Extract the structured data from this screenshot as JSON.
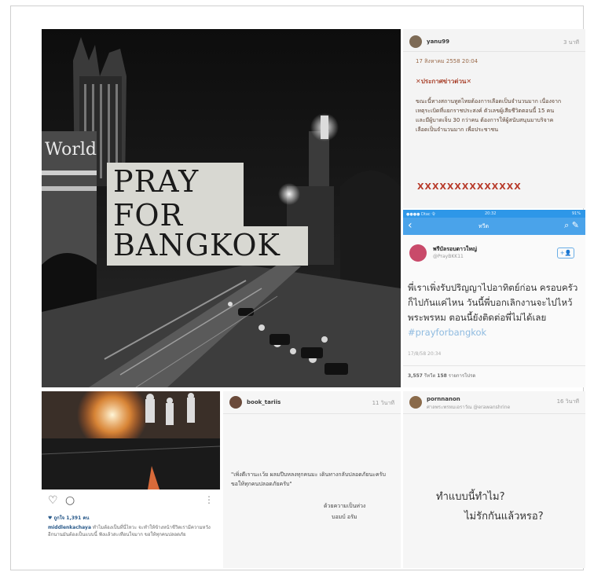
{
  "hero": {
    "line1": "PRAY",
    "line2": "FOR",
    "line3": "BANGKOK",
    "sign_text": "World"
  },
  "note_card": {
    "username": "yanu99",
    "ago": "3 นาที",
    "date": "17 สิงหาคม 2558 20:04",
    "heading": "ประกาศข่าวด่วน",
    "body": "ขณะนี้ทางสถานทูตไทยต้องการเลือดเป็นจำนวนมาก เนื่องจาก เหตุระเบิดที่แยกราชประสงค์ ตัวเลขผู้เสียชีวิตตอนนี้ 15 คน และมีผู้บาดเจ็บ 30 กว่าคน ต้องการให้ผู้สนับสนุนมาบริจาคเลือดเป็นจำนวนมาก เพื่อประชาชน",
    "x_mark": "✕",
    "x_row": "XXXXXXXXXXXXXX"
  },
  "tweet": {
    "status_left": "●●●● Dtac 令",
    "status_time": "20:32",
    "status_right": "91%",
    "title": "ทวีต",
    "back": "‹",
    "icons": "⌕  ✎",
    "display_name": "พรีบัลรอบตาวใหญ่",
    "handle": "@PrayBKK11",
    "follow": "+👤",
    "text": "พี่เราเพิ่งรับปริญญาไปอาทิตย์ก่อน ครอบครัวก็ไปกันแค่ไหน วันนี้พี่บอกเลิกงานจะไปไหว้พระพรหม ตอนนี้ยังติดต่อพี่ไม่ได้เลย",
    "hashtag": "#prayforbangkok",
    "time": "17/8/58 20:34",
    "retweets": "3,557",
    "retweets_label": "รีทวีต",
    "likes": "158",
    "likes_label": "รายการโปรด"
  },
  "insta": {
    "likes": "♥ ถูกใจ 1,391 คน",
    "caption_user": "middlenkachaya",
    "caption": "ทำไมต้องเป็นที่นี่ไหวะ จะทำให้ข้างหน้าชีวิตเรามีความหวังอีกนานมันต้องเป็นแบบนี้ ฟังแล้วสะเทือนใจมาก ขอให้ทุกคนปลอดภัย"
  },
  "card2": {
    "username": "book_tariis",
    "ago": "11 วินาที",
    "quote": "\"เพิ่งตีเรานะเว้ย ผลมปีบหลงทุกคนมะ เดินทางกลับปลอดภัยนะครับ ขอให้ทุกคนปลอดภัยครับ\"",
    "sign_line1": "ด้วยความเป็นห่วง",
    "sign_line2": "บอมบ์   อรัม"
  },
  "card3": {
    "username": "pornnanon",
    "subtitle": "ศาลพระพรหมเอราวัณ @erawanshrine",
    "ago": "16 วินาที",
    "line1": "ทำแบบนี้ทำไม?",
    "line2": "ไม่รักกันแล้วหรอ?"
  },
  "colors": {
    "twitter_blue": "#4aa3ea",
    "note_red": "#b83a2a",
    "card_bg": "#f6f6f6"
  }
}
